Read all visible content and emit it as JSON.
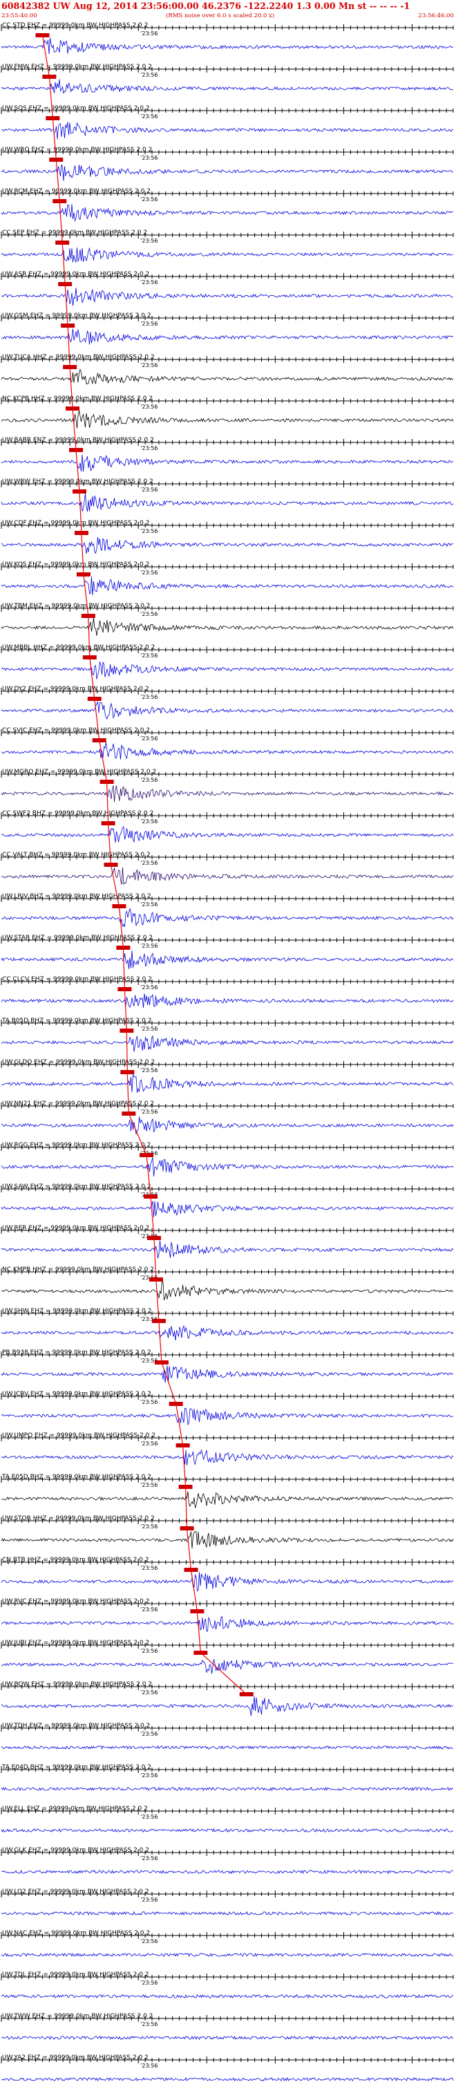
{
  "header": {
    "title": "60842382 UW Aug 12, 2014 23:56:00.00   46.2376 -122.2240  1.3 0.00 Mn st -- -- --   -1",
    "time_start": "23:55:40.00",
    "time_end": "23:56:46.00",
    "noise_note": "(RMS noise over 6.0 s scaled 20.0 x)"
  },
  "chart_data": {
    "type": "line",
    "trace_time_label": "23:56",
    "filter_suffix": "= 99999.0km BW  HIGHPASS  2.0  2",
    "x_range_s": [
      0,
      66
    ],
    "stations": [
      {
        "code": "CC.STD EHZ",
        "color": "#0000e0",
        "pick_s": 6.0
      },
      {
        "code": "UW.FMW EHZ",
        "color": "#0000e0",
        "pick_s": 7.0
      },
      {
        "code": "UW.SOS EHZ",
        "color": "#0000e0",
        "pick_s": 7.5
      },
      {
        "code": "UW.WRO EHZ",
        "color": "#0000e0",
        "pick_s": 8.0
      },
      {
        "code": "UW.RCM EHZ",
        "color": "#0000e0",
        "pick_s": 8.5
      },
      {
        "code": "CC.SEP EHZ",
        "color": "#0000e0",
        "pick_s": 8.9
      },
      {
        "code": "UW.ASR EHZ",
        "color": "#0000e0",
        "pick_s": 9.3
      },
      {
        "code": "UW.GSM EHZ",
        "color": "#0000e0",
        "pick_s": 9.7
      },
      {
        "code": "UW.TUCA HHZ",
        "color": "#000000",
        "pick_s": 10.0
      },
      {
        "code": "NC.KCPB HHZ",
        "color": "#000000",
        "pick_s": 10.4
      },
      {
        "code": "UW.BABR ENZ",
        "color": "#0000e0",
        "pick_s": 10.9
      },
      {
        "code": "UW.WRW EHZ",
        "color": "#0000e0",
        "pick_s": 11.4
      },
      {
        "code": "UW.CDF EHZ",
        "color": "#0000e0",
        "pick_s": 11.7
      },
      {
        "code": "UW.KOS EHZ",
        "color": "#0000e0",
        "pick_s": 12.0
      },
      {
        "code": "UW.TBM EHZ",
        "color": "#000000",
        "pick_s": 12.7
      },
      {
        "code": "UW.MBBL HHZ",
        "color": "#0000e0",
        "pick_s": 12.9
      },
      {
        "code": "UW.DY2 EHZ",
        "color": "#0000e0",
        "pick_s": 13.6
      },
      {
        "code": "CC.SVIC EHZ",
        "color": "#0000e0",
        "pick_s": 14.3
      },
      {
        "code": "UW.MGRO EHZ",
        "color": "#2a0a6e",
        "pick_s": 15.4
      },
      {
        "code": "CC.SWF2 BHZ",
        "color": "#0000e0",
        "pick_s": 15.6
      },
      {
        "code": "CC.VALT BHZ",
        "color": "#2a0a6e",
        "pick_s": 16.0
      },
      {
        "code": "UW.LRIV BHZ",
        "color": "#0000e0",
        "pick_s": 17.2
      },
      {
        "code": "UW.STAR EHZ",
        "color": "#0000e0",
        "pick_s": 17.8
      },
      {
        "code": "CC.CLCV EHZ",
        "color": "#0000e0",
        "pick_s": 18.0
      },
      {
        "code": "TA.B05D BHZ",
        "color": "#0000e0",
        "pick_s": 18.3
      },
      {
        "code": "UW.GLDO EHZ",
        "color": "#0000e0",
        "pick_s": 18.4
      },
      {
        "code": "UW.NN21 EHZ",
        "color": "#0000e0",
        "pick_s": 18.6
      },
      {
        "code": "UW.RGG EHZ",
        "color": "#0000e0",
        "pick_s": 21.2
      },
      {
        "code": "UW.SAW EHZ",
        "color": "#0000e0",
        "pick_s": 21.8
      },
      {
        "code": "UW.RER EHZ",
        "color": "#0000e0",
        "pick_s": 22.3
      },
      {
        "code": "NC.KMPB HHZ",
        "color": "#000000",
        "pick_s": 22.6
      },
      {
        "code": "UW.SHW EHZ",
        "color": "#0000e0",
        "pick_s": 23.0
      },
      {
        "code": "PB.B938 EHZ",
        "color": "#0000e0",
        "pick_s": 23.4
      },
      {
        "code": "UW.JCRV EHZ",
        "color": "#0000e0",
        "pick_s": 25.5
      },
      {
        "code": "UW.UMPO EHZ",
        "color": "#0000e0",
        "pick_s": 26.5
      },
      {
        "code": "TA.E05D BHZ",
        "color": "#000000",
        "pick_s": 26.9
      },
      {
        "code": "UW.STOR HHZ",
        "color": "#000000",
        "pick_s": 27.1
      },
      {
        "code": "CN.BTB HHZ",
        "color": "#0000e0",
        "pick_s": 27.7
      },
      {
        "code": "UW.RVC EHZ",
        "color": "#0000e0",
        "pick_s": 28.6
      },
      {
        "code": "UW.JUBI EHZ",
        "color": "#0000e0",
        "pick_s": 29.1
      },
      {
        "code": "UW.BOW EHZ",
        "color": "#0000e0",
        "pick_s": 35.8
      },
      {
        "code": "UW.TDH EHZ",
        "color": "#0000e0",
        "pick_s": null
      },
      {
        "code": "TA.E04D BHZ",
        "color": "#0000e0",
        "pick_s": null
      },
      {
        "code": "UW.ELL EHZ",
        "color": "#0000e0",
        "pick_s": null
      },
      {
        "code": "UW.GLK EHZ",
        "color": "#0000e0",
        "pick_s": null
      },
      {
        "code": "UW.LO2 EHZ",
        "color": "#0000e0",
        "pick_s": null
      },
      {
        "code": "UW.NAC EHZ",
        "color": "#0000e0",
        "pick_s": null
      },
      {
        "code": "UW.TDL EHZ",
        "color": "#0000e0",
        "pick_s": null
      },
      {
        "code": "UW.TWW EHZ",
        "color": "#0000e0",
        "pick_s": null
      },
      {
        "code": "UW.YA2 EHZ",
        "color": "#0000e0",
        "pick_s": null
      }
    ],
    "colors": {
      "header_text": "#d40000",
      "pick_marker": "#cc0000",
      "pick_line": "#ee0000",
      "tick": "#000000"
    }
  }
}
